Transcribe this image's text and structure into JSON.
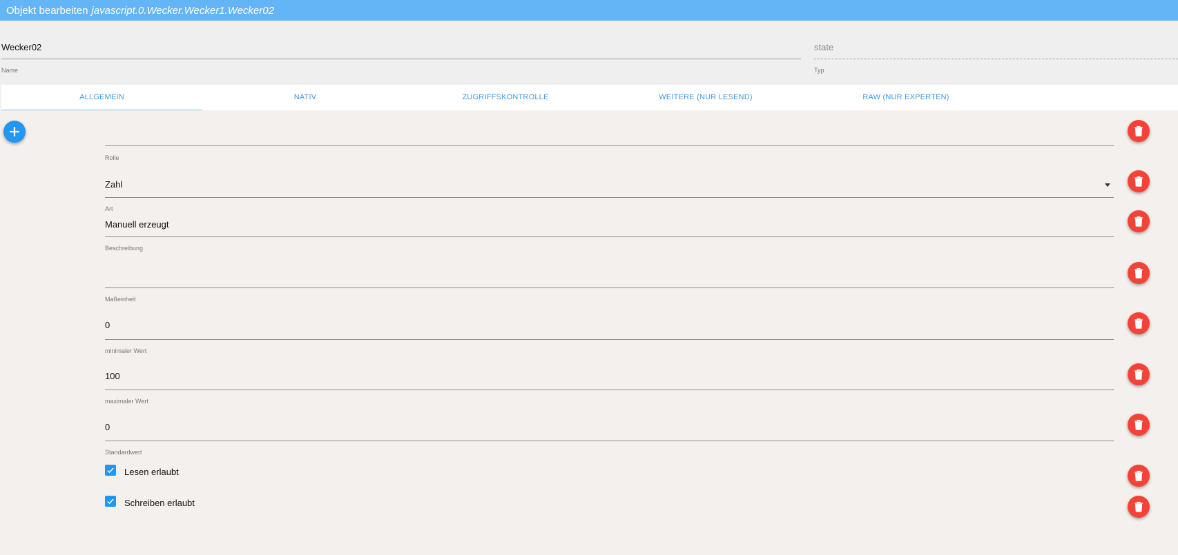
{
  "title": {
    "prefix": "Objekt bearbeiten",
    "object_id": "javascript.0.Wecker.Wecker1.Wecker02"
  },
  "header": {
    "name": {
      "value": "Wecker02",
      "label": "Name"
    },
    "type": {
      "value": "state",
      "label": "Typ"
    }
  },
  "tabs": [
    {
      "label": "ALLGEMEIN",
      "active": true
    },
    {
      "label": "NATIV",
      "active": false
    },
    {
      "label": "ZUGRIFFSKONTROLLE",
      "active": false
    },
    {
      "label": "WEITERE (NUR LESEND)",
      "active": false
    },
    {
      "label": "RAW (NUR EXPERTEN)",
      "active": false
    }
  ],
  "fields": {
    "rolle": {
      "value": "",
      "label": "Rolle"
    },
    "art": {
      "value": "Zahl",
      "label": "Art"
    },
    "beschreibung": {
      "value": "Manuell erzeugt",
      "label": "Beschreibung"
    },
    "masseinheit": {
      "value": "",
      "label": "Maßeinheit"
    },
    "min": {
      "value": "0",
      "label": "minimaler Wert"
    },
    "max": {
      "value": "100",
      "label": "maximaler Wert"
    },
    "standard": {
      "value": "0",
      "label": "Standardwert"
    }
  },
  "checkboxes": {
    "read": {
      "label": "Lesen erlaubt",
      "checked": true
    },
    "write": {
      "label": "Schreiben erlaubt",
      "checked": true
    }
  },
  "colors": {
    "accent": "#2196f3",
    "danger": "#f44336",
    "titlebar": "#64b5f6",
    "tab_text": "#3a9ae6"
  },
  "icons": {
    "add": "plus-icon",
    "delete": "trash-icon",
    "check": "check-icon",
    "dropdown": "caret-down-icon"
  }
}
